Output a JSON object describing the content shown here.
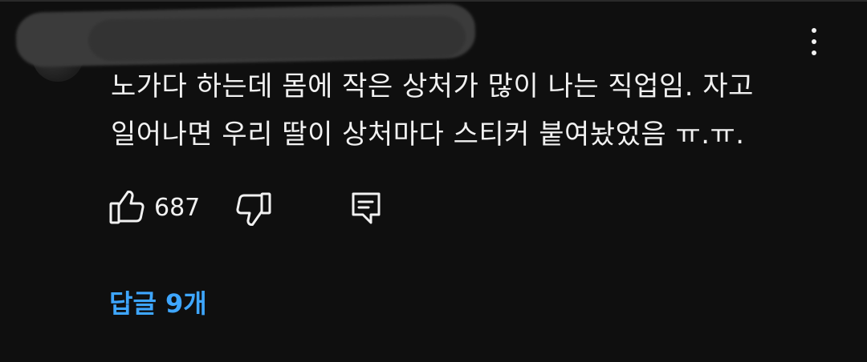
{
  "comment": {
    "author": "@",
    "lines": [
      "노가다 하는데 몸에 작은 상처가 많이 나는 직업임. 자고",
      "일어나면 우리 딸이 상처마다 스티커 붙여놨었음 ㅠ.ㅠ."
    ]
  },
  "actions": {
    "like_icon": "thumbs-up-icon",
    "like_count": "687",
    "dislike_icon": "thumbs-down-icon",
    "reply_icon": "comment-reply-icon"
  },
  "menu": {
    "icon": "more-vertical-icon"
  },
  "replies": {
    "label": "답글 9개"
  },
  "colors": {
    "background": "#0f0f0f",
    "text": "#f1f1f1",
    "link": "#3ea6ff",
    "redaction": "#3b3b3b"
  }
}
